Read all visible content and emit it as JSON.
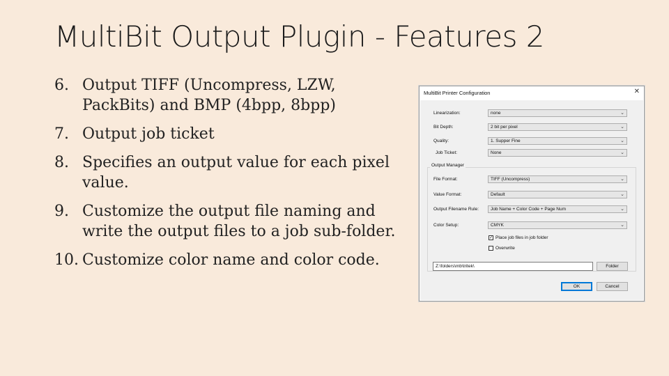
{
  "slide": {
    "title": "MultiBit Output Plugin - Features 2",
    "bullets": [
      {
        "num": "6.",
        "text": "Output TIFF (Uncompress, LZW, PackBits) and BMP (4bpp, 8bpp)"
      },
      {
        "num": "7.",
        "text": "Output job ticket"
      },
      {
        "num": "8.",
        "text": "Specifies an output value for each pixel value."
      },
      {
        "num": "9.",
        "text": "Customize the output file naming and write the output files to a job sub-folder."
      },
      {
        "num": "10.",
        "text": "Customize color name and color code."
      }
    ]
  },
  "dialog": {
    "title": "MultiBit Printer Configuration",
    "close_icon": "✕",
    "linearization": {
      "label": "Linearization:",
      "value": "none"
    },
    "bit_depth": {
      "label": "Bit Depth:",
      "value": "2 bit per pixel"
    },
    "quality": {
      "label": "Quality:",
      "value": "1. Supper Fine"
    },
    "job_ticket": {
      "label": "Job Ticket:",
      "value": "None"
    },
    "output_manager": {
      "label": "Output Manager",
      "file_format": {
        "label": "File Format:",
        "value": "TIFF (Uncompress)"
      },
      "value_format": {
        "label": "Value Format:",
        "value": "Default"
      },
      "filename_rule": {
        "label": "Output Filename Rule:",
        "value": "Job Name + Color Code + Page Num"
      },
      "color_setup": {
        "label": "Color Setup:",
        "value": "CMYK"
      },
      "place_in_job_folder": {
        "label": "Place job files in job folder",
        "checked": true,
        "mark": "✓"
      },
      "overwrite": {
        "label": "Overwrite",
        "checked": false
      }
    },
    "folder_path": "Z:\\folders\\mb\\tritek\\",
    "folder_button": "Folder",
    "ok_button": "OK",
    "cancel_button": "Cancel",
    "dropdown_arrow": "⌄"
  }
}
